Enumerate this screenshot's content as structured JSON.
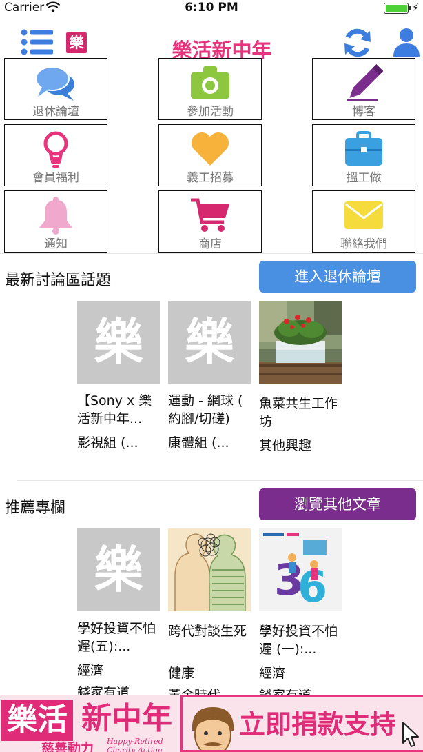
{
  "status_bar": {
    "carrier": "Carrier",
    "time": "6:10 PM"
  },
  "nav": {
    "title": "樂活新中年",
    "logo": "樂",
    "menu_icon": "list-icon",
    "refresh_icon": "refresh-icon",
    "profile_icon": "user-icon"
  },
  "grid": [
    {
      "label": "退休論壇",
      "icon": "chat-bubbles-icon",
      "color": "#4a8fe0"
    },
    {
      "label": "參加活動",
      "icon": "camera-icon",
      "color": "#8dc63f"
    },
    {
      "label": "博客",
      "icon": "pencil-icon",
      "color": "#7b2d8e"
    },
    {
      "label": "會員福利",
      "icon": "lightbulb-icon",
      "color": "#e8347c"
    },
    {
      "label": "義工招募",
      "icon": "heart-icon",
      "color": "#f7b23b"
    },
    {
      "label": "搵工做",
      "icon": "briefcase-icon",
      "color": "#3aa0e0"
    },
    {
      "label": "通知",
      "icon": "bell-icon",
      "color": "#f0a8cc"
    },
    {
      "label": "商店",
      "icon": "shopping-cart-icon",
      "color": "#d6286e"
    },
    {
      "label": "聯絡我們",
      "icon": "envelope-icon",
      "color": "#f5dc3c"
    }
  ],
  "forum_section": {
    "title": "最新討論區話題",
    "button": "進入退休論壇",
    "button_color": "#4a90e2",
    "items": [
      {
        "thumb": "樂",
        "title": "【Sony x 樂活新中年...",
        "category": "影視組 (..."
      },
      {
        "thumb": "樂",
        "title": "運動 - 網球 ( 約腳/切磋)",
        "category": "康體組 (..."
      },
      {
        "thumb": "",
        "title": "魚菜共生工作坊",
        "category": "其他興趣"
      }
    ]
  },
  "column_section": {
    "title": "推薦專欄",
    "button": "瀏覽其他文章",
    "button_color": "#7b2d8e",
    "items": [
      {
        "thumb": "樂",
        "title": "學好投資不怕遲(五):...",
        "category": "經濟",
        "subtitle": "錢家有道"
      },
      {
        "thumb": "",
        "title": "跨代對談生死",
        "category": "健康",
        "subtitle": "黃金時代..."
      },
      {
        "thumb": "",
        "title": "學好投資不怕遲 (一):...",
        "category": "經濟",
        "subtitle": "錢家有道"
      }
    ]
  },
  "banner": {
    "logo_main": "樂活",
    "logo_sub": "新中年",
    "tagline": "慈善動力",
    "tagline_en": "Happy-Retired Charity Action",
    "donate": "立即捐款支持"
  }
}
